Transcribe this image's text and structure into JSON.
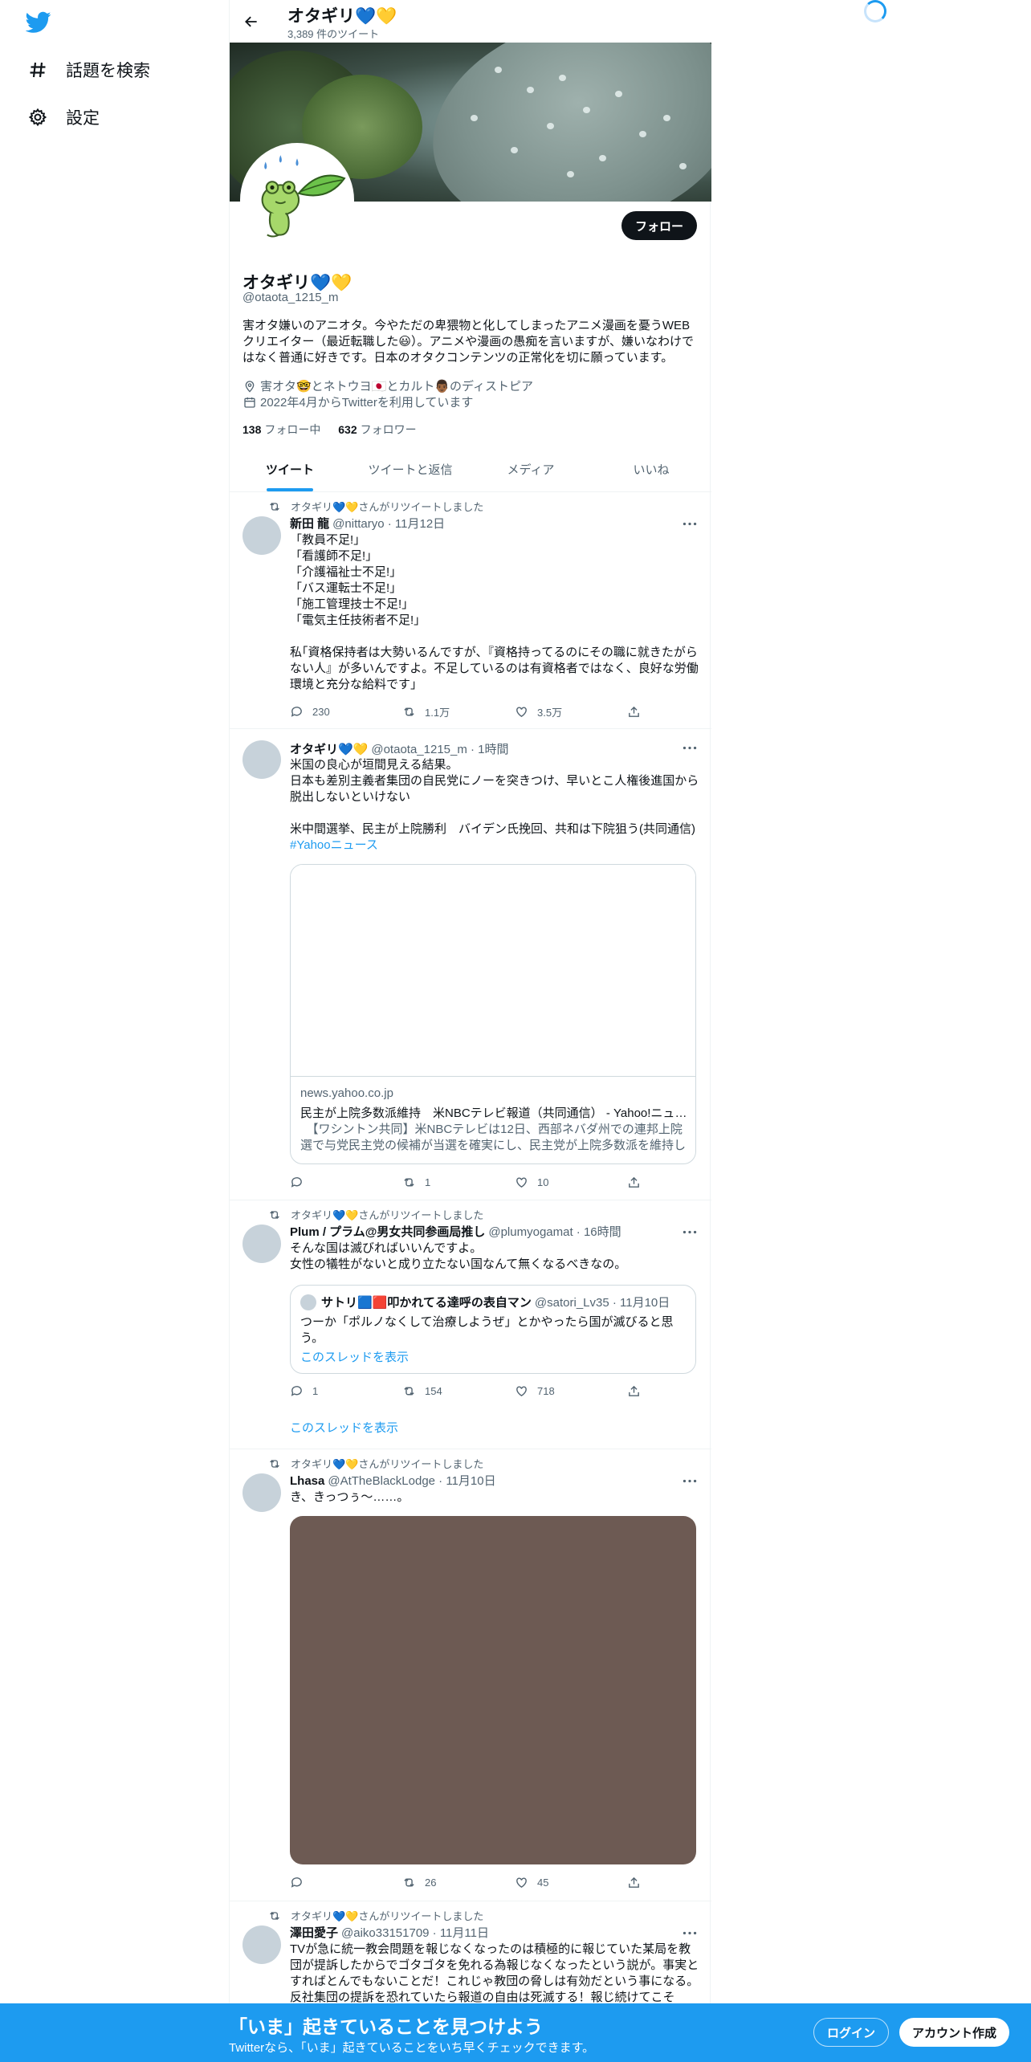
{
  "colors": {
    "accent": "#1d9bf0",
    "text": "#0f1419",
    "muted": "#536471",
    "border": "#eff3f4"
  },
  "nav": {
    "logo_icon": "twitter-bird-icon",
    "items": [
      {
        "label": "話題を検索",
        "icon": "hashtag-icon"
      },
      {
        "label": "設定",
        "icon": "gear-icon"
      }
    ]
  },
  "header": {
    "name": "オタギリ💙💛",
    "tweet_count": "3,389 件のツイート"
  },
  "profile": {
    "follow_label": "フォロー",
    "name": "オタギリ💙💛",
    "handle": "@otaota_1215_m",
    "bio": "害オタ嫌いのアニオタ。今やただの卑猥物と化してしまったアニメ漫画を憂うWEBクリエイター（最近転職した😃）。アニメや漫画の愚痴を言いますが、嫌いなわけではなく普通に好きです。日本のオタクコンテンツの正常化を切に願っています。",
    "location": "害オタ🤓とネトウヨ🇯🇵とカルト👨🏾のディストピア",
    "joined": "2022年4月からTwitterを利用しています",
    "following_count": "138",
    "following_label": "フォロー中",
    "followers_count": "632",
    "followers_label": "フォロワー"
  },
  "tabs": [
    {
      "label": "ツイート",
      "active": true
    },
    {
      "label": "ツイートと返信",
      "active": false
    },
    {
      "label": "メディア",
      "active": false
    },
    {
      "label": "いいね",
      "active": false
    }
  ],
  "tweets": [
    {
      "retweet_by": "オタギリ💙💛さんがリツイートしました",
      "name": "新田 龍",
      "meta": "@nittaryo · 11月12日",
      "text": "「教員不足!」\n「看護師不足!」\n「介護福祉士不足!」\n「バス運転士不足!」\n「施工管理技士不足!」\n「電気主任技術者不足!」\n\n私｢資格保持者は大勢いるんですが、『資格持ってるのにその職に就きたがらない人』が多いんですよ。不足しているのは有資格者ではなく、良好な労働環境と充分な給料です｣",
      "replies": "230",
      "retweets": "1.1万",
      "likes": "3.5万"
    },
    {
      "name": "オタギリ💙💛",
      "meta": "@otaota_1215_m · 1時間",
      "text": "米国の良心が垣間見える結果。\n日本も差別主義者集団の自民党にノーを突きつけ、早いとこ人権後進国から脱出しないといけない\n\n米中間選挙、民主が上院勝利　バイデン氏挽回、共和は下院狙う(共同通信)",
      "hashtag": "#Yahooニュース",
      "card": {
        "domain": "news.yahoo.co.jp",
        "title": "民主が上院多数派維持　米NBCテレビ報道（共同通信） - Yahoo!ニュース",
        "desc": "　【ワシントン共同】米NBCテレビは12日、西部ネバダ州での連邦上院選で与党民主党の候補が当選を確実にし、民主党が上院多数派を維持したと報じた。"
      },
      "replies": "",
      "retweets": "1",
      "likes": "10"
    },
    {
      "retweet_by": "オタギリ💙💛さんがリツイートしました",
      "name": "Plum / プラム@男女共同参画局推し",
      "meta": "@plumyogamat · 16時間",
      "text": "そんな国は滅びればいいんですよ。\n女性の犠牲がないと成り立たない国なんて無くなるべきなの。",
      "quote": {
        "name": "サトリ🟦🟥叩かれてる達呼の表自マン",
        "meta": "@satori_Lv35 · 11月10日",
        "text": "つーか「ポルノなくして治療しようぜ」とかやったら国が滅びると思う。",
        "link": "このスレッドを表示"
      },
      "replies": "1",
      "retweets": "154",
      "likes": "718",
      "thread_link": "このスレッドを表示"
    },
    {
      "retweet_by": "オタギリ💙💛さんがリツイートしました",
      "name": "Lhasa",
      "meta": "@AtTheBlackLodge · 11月10日",
      "text": "き、きっつぅ〜……。",
      "replies": "",
      "retweets": "26",
      "likes": "45"
    },
    {
      "retweet_by": "オタギリ💙💛さんがリツイートしました",
      "name": "澤田愛子",
      "meta": "@aiko33151709 · 11月11日",
      "text": "TVが急に統一教会問題を報じなくなったのは積極的に報じていた某局を教団が提訴したからでゴタゴタを免れる為報じなくなったという説が。事実とすればとんでもないことだ！これじゃ教団の脅しは有効だという事になる。反社集団の提訴を恐れていたら報道の自由は死滅する！報じ続けてこそ"
    }
  ],
  "bottom_bar": {
    "title": "「いま」起きていることを見つけよう",
    "subtitle": "Twitterなら、「いま」起きていることをいち早くチェックできます。",
    "login": "ログイン",
    "signup": "アカウント作成"
  }
}
